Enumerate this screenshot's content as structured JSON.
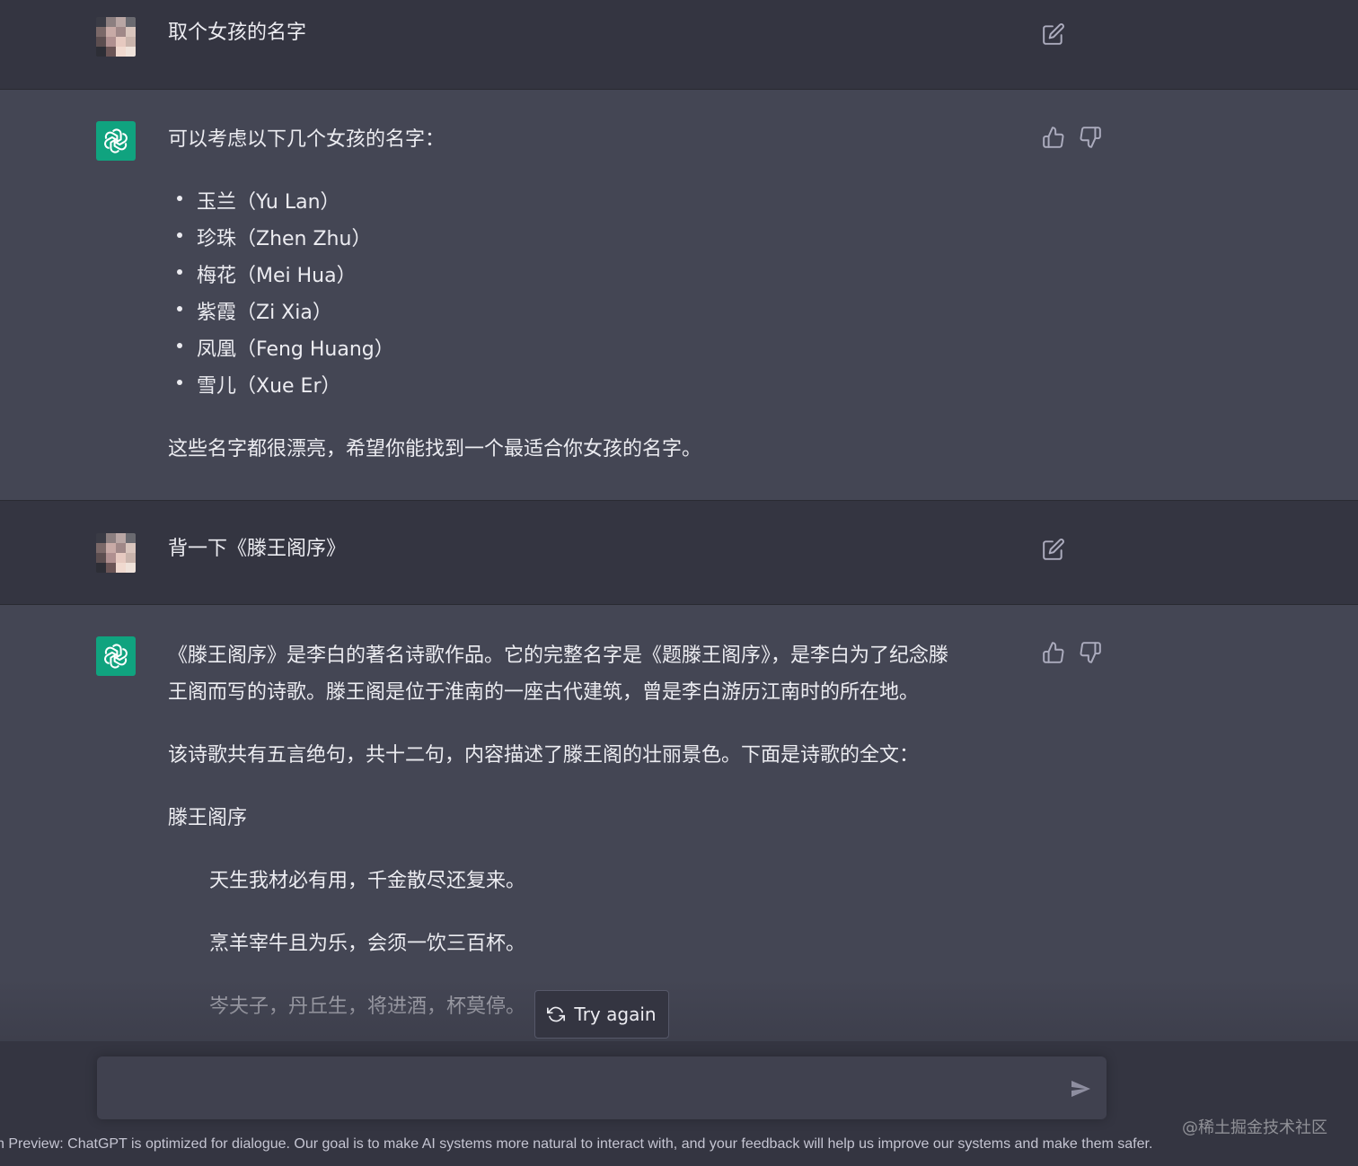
{
  "colors": {
    "user_row_bg": "#343541",
    "assistant_row_bg": "#444654",
    "gpt_avatar": "#10a37f",
    "text": "#ececf1",
    "icon": "#acacbe"
  },
  "conversation": [
    {
      "role": "user",
      "text": "取个女孩的名字"
    },
    {
      "role": "assistant",
      "intro": "可以考虑以下几个女孩的名字：",
      "names": [
        "玉兰（Yu Lan）",
        "珍珠（Zhen Zhu）",
        "梅花（Mei Hua）",
        "紫霞（Zi Xia）",
        "凤凰（Feng Huang）",
        "雪儿（Xue Er）"
      ],
      "outro": "这些名字都很漂亮，希望你能找到一个最适合你女孩的名字。"
    },
    {
      "role": "user",
      "text": "背一下《滕王阁序》"
    },
    {
      "role": "assistant",
      "para1_line1": "《滕王阁序》是李白的著名诗歌作品。它的完整名字是《题滕王阁序》，是李白为了纪念滕",
      "para1_line2": "王阁而写的诗歌。滕王阁是位于淮南的一座古代建筑，曾是李白游历江南时的所在地。",
      "para2": "该诗歌共有五言绝句，共十二句，内容描述了滕王阁的壮丽景色。下面是诗歌的全文：",
      "poem_title": "滕王阁序",
      "poem_lines": [
        "天生我材必有用，千金散尽还复来。",
        "烹羊宰牛且为乐，会须一饮三百杯。",
        "岑夫子，丹丘生，将进酒，杯莫停。"
      ]
    }
  ],
  "controls": {
    "try_again_label": "Try again",
    "input_placeholder": ""
  },
  "footer": {
    "text": "h Preview: ChatGPT is optimized for dialogue. Our goal is to make AI systems more natural to interact with, and your feedback will help us improve our systems and make them safer.",
    "watermark": "@稀土掘金技术社区"
  },
  "icons": {
    "edit": "edit-icon",
    "thumbs_up": "thumbs-up-icon",
    "thumbs_down": "thumbs-down-icon",
    "gpt_logo": "openai-logo-icon",
    "refresh": "refresh-icon",
    "send": "send-icon"
  }
}
